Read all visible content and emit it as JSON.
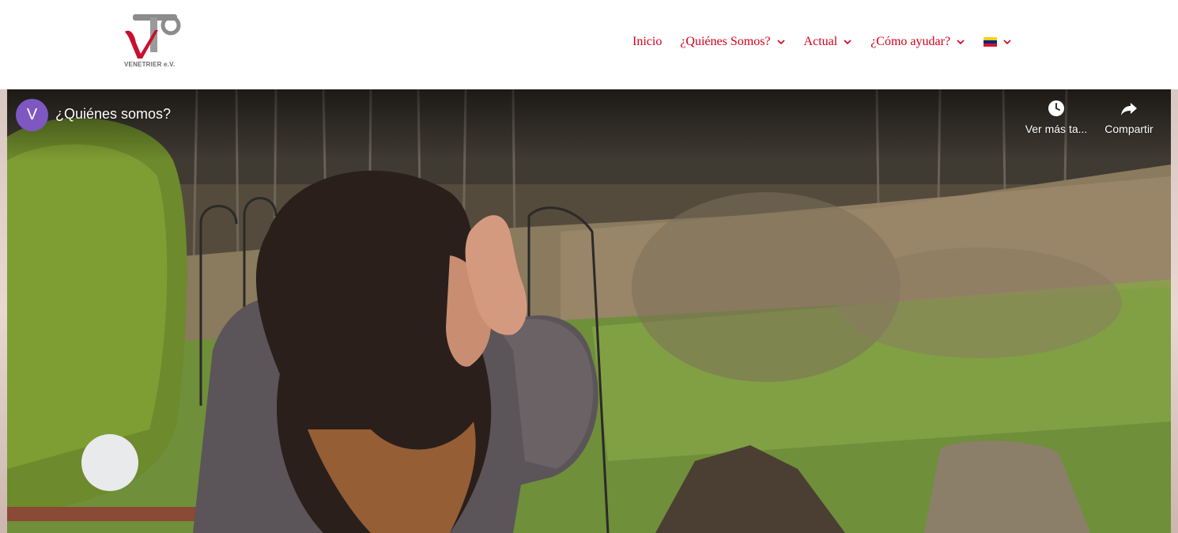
{
  "logo": {
    "text": "VENETRIER e.V."
  },
  "nav": {
    "items": [
      {
        "label": "Inicio",
        "has_dropdown": false
      },
      {
        "label": "¿Quiénes Somos?",
        "has_dropdown": true
      },
      {
        "label": "Actual",
        "has_dropdown": true
      },
      {
        "label": "¿Cómo ayudar?",
        "has_dropdown": true
      }
    ],
    "language_flag": "venezuela-flag-icon"
  },
  "video": {
    "channel_initial": "V",
    "title": "¿Quiénes somos?",
    "watch_later_label": "Ver más ta...",
    "share_label": "Compartir"
  },
  "colors": {
    "nav_link": "#d4001a",
    "avatar": "#7e57c2",
    "flag_yellow": "#f7d117",
    "flag_blue": "#00247d",
    "flag_red": "#cf142b"
  }
}
